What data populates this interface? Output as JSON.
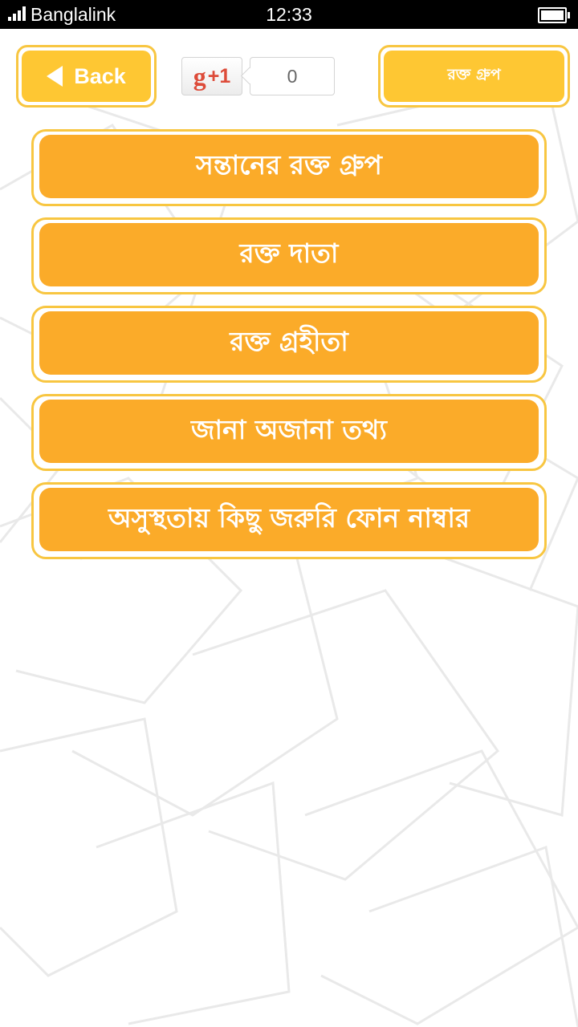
{
  "status_bar": {
    "carrier": "Banglalink",
    "time": "12:33"
  },
  "header": {
    "back_label": "Back",
    "gplus_label": "+1",
    "gplus_count": "0",
    "title": "রক্ত গ্রুপ"
  },
  "menu": {
    "items": [
      {
        "label": "সন্তানের রক্ত গ্রুপ"
      },
      {
        "label": "রক্ত দাতা"
      },
      {
        "label": "রক্ত গ্রহীতা"
      },
      {
        "label": "জানা অজানা তথ্য"
      },
      {
        "label": "অসুস্থতায় কিছু জরুরি ফোন নাম্বার"
      }
    ]
  },
  "colors": {
    "button_fill": "#fbab29",
    "header_button_fill": "#fec733",
    "button_border": "#f8c641",
    "gplus_red": "#dd4b39"
  },
  "icons": {
    "back": "back-arrow-icon",
    "gplus": "google-plus-icon",
    "signal": "signal-icon",
    "battery": "battery-icon"
  }
}
